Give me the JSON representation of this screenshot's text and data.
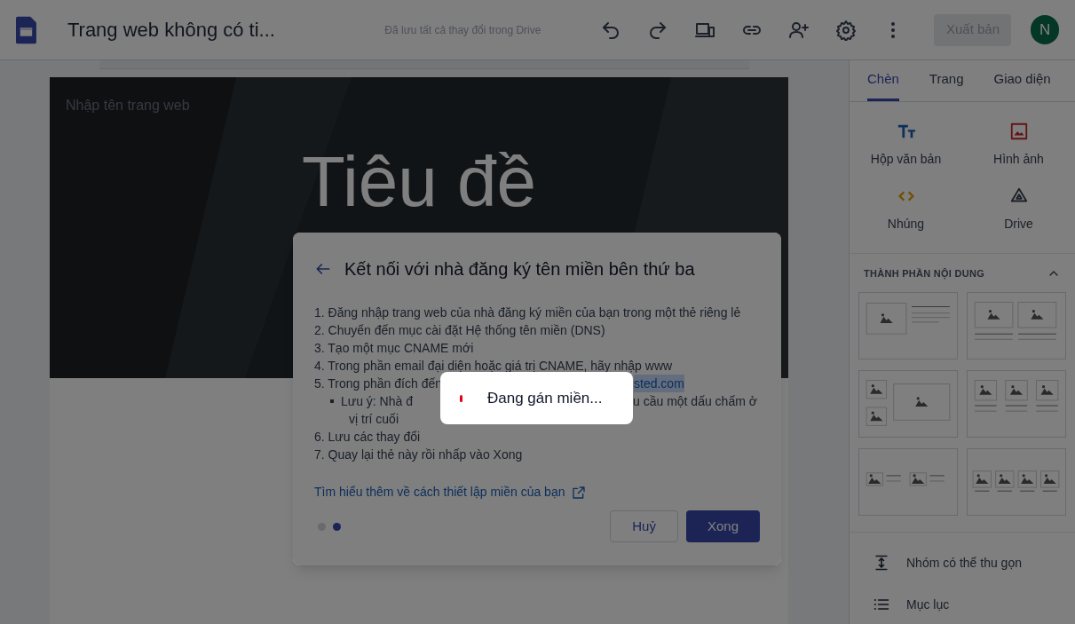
{
  "app_bar": {
    "title": "Trang web không có ti...",
    "save_status": "Đã lưu tất cả thay đổi trong Drive",
    "publish": {
      "label": "Xuất bản",
      "disabled": true
    },
    "avatar": "N"
  },
  "site": {
    "name_placeholder": "Nhập tên trang web",
    "page_title": "Tiêu đề"
  },
  "side_panel": {
    "tabs": [
      {
        "label": "Chèn",
        "selected": true
      },
      {
        "label": "Trang",
        "selected": false
      },
      {
        "label": "Giao diện",
        "selected": false
      }
    ],
    "insert_items": [
      {
        "kind": "text",
        "label": "Hộp văn bản"
      },
      {
        "kind": "image",
        "label": "Hình ảnh"
      },
      {
        "kind": "embed",
        "label": "Nhúng"
      },
      {
        "kind": "drive",
        "label": "Drive"
      }
    ],
    "section_title": "THÀNH PHẦN NỘI DUNG",
    "section_expanded": true,
    "bottom_items": [
      {
        "kind": "collapsible",
        "label": "Nhóm có thể thu gọn"
      },
      {
        "kind": "toc",
        "label": "Mục lục"
      }
    ]
  },
  "dialog": {
    "title": "Kết nối với nhà đăng ký tên miền bên thứ ba",
    "steps": [
      {
        "kind": "step",
        "text": "1. Đăng nhập trang web của nhà đăng ký miền của bạn trong một thẻ riêng lẻ"
      },
      {
        "kind": "step",
        "text": "2. Chuyển đến mục cài đặt Hệ thống tên miền (DNS)"
      },
      {
        "kind": "step",
        "text": "3. Tạo một mục CNAME mới"
      },
      {
        "kind": "step",
        "text": "4. Trong phần email đại diện hoặc giá trị CNAME, hãy nhập www"
      },
      {
        "kind": "split",
        "before": "5. Trong phần đích đến",
        "after": "sted.com"
      },
      {
        "kind": "note",
        "before": "Lưu ý: Nhà đ",
        "after": "u cầu một dấu chấm ở",
        "rest": "vị trí cuối"
      },
      {
        "kind": "step",
        "text": "6. Lưu các thay đổi"
      },
      {
        "kind": "step",
        "text": "7. Quay lại thẻ này rồi nhấp vào Xong"
      }
    ],
    "link": "Tìm hiểu thêm về cách thiết lập miền của bạn",
    "pages": [
      {
        "selected": false
      },
      {
        "selected": true
      }
    ],
    "buttons": [
      {
        "kind": "secondary",
        "label": "Huỷ"
      },
      {
        "kind": "primary",
        "label": "Xong"
      }
    ]
  },
  "toast": {
    "text": "Đang gán miền..."
  }
}
